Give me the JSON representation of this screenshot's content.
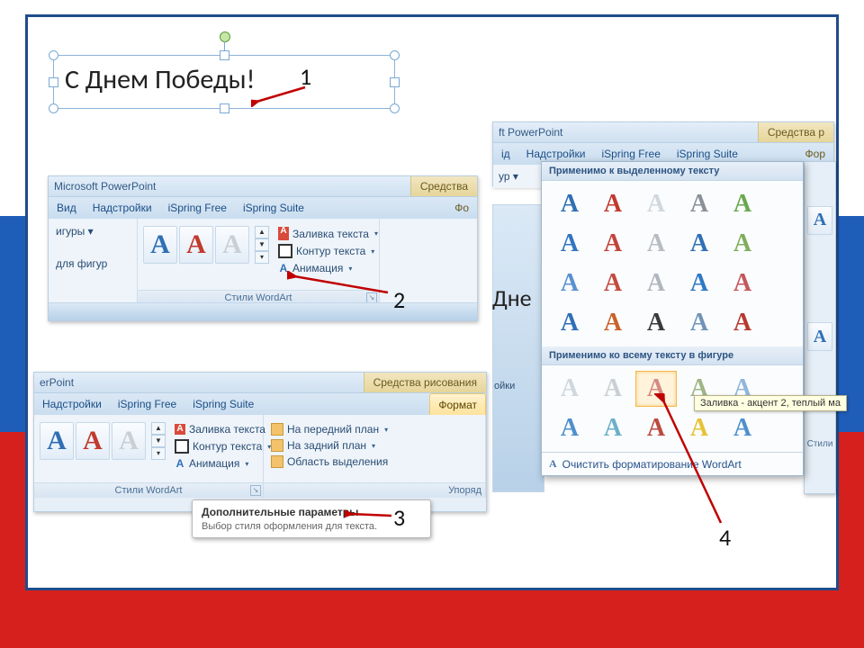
{
  "textbox": {
    "text": "С Днем Победы!"
  },
  "labels": {
    "n1": "1",
    "n2": "2",
    "n3": "3",
    "n4": "4"
  },
  "app": {
    "title_full": "Microsoft PowerPoint",
    "title_short_a": "ft PowerPoint",
    "title_short_b": "erPoint",
    "ctx_tools": "Средства рисования",
    "ctx_tools_short": "Средства р",
    "ctx_tools_mid": "Средства"
  },
  "tabs": {
    "view": "Вид",
    "view_short": "ід",
    "addins": "Надстройки",
    "addins_short": "ойки",
    "ispring_free": "iSpring Free",
    "ispring_suite": "iSpring Suite",
    "format": "Формат",
    "format_short": "Фо",
    "format_pre": "Фор"
  },
  "ribbon": {
    "shapes_short": "игуры ▾",
    "for_shapes_short": "для фигур",
    "shapes_short2": "ур ▾",
    "wordart_styles": "Стили WordArt",
    "styles_short": "Стили",
    "text_fill": "Заливка текста",
    "text_outline": "Контур текста",
    "animation": "Анимация",
    "bring_front": "На передний план",
    "send_back": "На задний план",
    "selection_pane": "Область выделения",
    "arrange_short": "Упоряд"
  },
  "tooltip": {
    "title": "Дополнительные параметры",
    "body": "Выбор стиля оформления для текста."
  },
  "gallery": {
    "hdr1": "Применимо к выделенному тексту",
    "hdr2": "Применимо ко всему тексту в фигуре",
    "clear": "Очистить форматирование WordArt",
    "hover_tip": "Заливка - акцент 2, теплый ма",
    "colors_row1": [
      "#2f6fb5",
      "#c13a2f",
      "#cfd8de",
      "#8a9098",
      "#6aa84f"
    ],
    "colors_row2": [
      "#3275c0",
      "#c3443a",
      "#b6bcc2",
      "#2f6fb5",
      "#7fae5b"
    ],
    "colors_row3": [
      "#5a91cf",
      "#c24a40",
      "#b0b6bd",
      "#2f78c6",
      "#c5575a"
    ],
    "colors_row4": [
      "#2f6fb5",
      "#c9622a",
      "#3a3a3a",
      "#6f94b7",
      "#b8392f"
    ],
    "colors2_row1": [
      "#d0d8de",
      "#c9cfd4",
      "#d68b82",
      "#9fb586",
      "#8fb6da"
    ],
    "colors2_row2": [
      "#4f8fcd",
      "#6bb0c7",
      "#bb4a3f",
      "#e6c236",
      "#4f8fcd"
    ]
  },
  "frag": {
    "dne": "Дне"
  }
}
